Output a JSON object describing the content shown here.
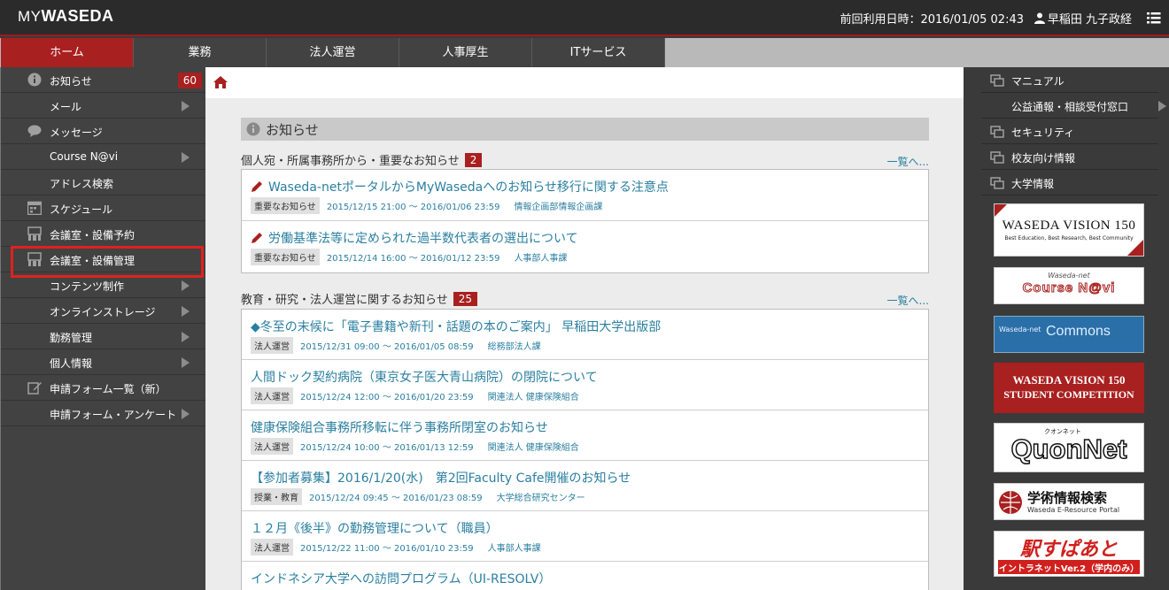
{
  "header": {
    "logo_my": "MY",
    "logo_name": "WASEDA",
    "last_login": "前回利用日時：2016/01/05 02:43",
    "user_name": "早稲田 九子政経"
  },
  "nav": {
    "tabs": [
      {
        "label": "ホーム"
      },
      {
        "label": "業務"
      },
      {
        "label": "法人運営"
      },
      {
        "label": "人事厚生"
      },
      {
        "label": "ITサービス"
      }
    ]
  },
  "sidebar": {
    "items": [
      {
        "label": "お知らせ",
        "badge": "60"
      },
      {
        "label": "メール"
      },
      {
        "label": "メッセージ"
      },
      {
        "label": "Course N@vi"
      },
      {
        "label": "アドレス検索"
      },
      {
        "label": "スケジュール"
      },
      {
        "label": "会議室・設備予約"
      },
      {
        "label": "会議室・設備管理"
      },
      {
        "label": "コンテンツ制作"
      },
      {
        "label": "オンラインストレージ"
      },
      {
        "label": "勤務管理"
      },
      {
        "label": "個人情報"
      },
      {
        "label": "申請フォーム一覧（新）"
      },
      {
        "label": "申請フォーム・アンケート"
      }
    ]
  },
  "main": {
    "section_title": "お知らせ",
    "groups": [
      {
        "title": "個人宛・所属事務所から・重要なお知らせ",
        "count": "2",
        "more": "一覧へ...",
        "items": [
          {
            "title": "Waseda-netポータルからMyWasedaへのお知らせ移行に関する注意点",
            "tag": "重要なお知らせ",
            "period": "2015/12/15 21:00 ～ 2016/01/06 23:59",
            "dept": "情報企画部情報企画課"
          },
          {
            "title": "労働基準法等に定められた過半数代表者の選出について",
            "tag": "重要なお知らせ",
            "period": "2015/12/14 16:00 ～ 2016/01/12 23:59",
            "dept": "人事部人事課"
          }
        ]
      },
      {
        "title": "教育・研究・法人運営に関するお知らせ",
        "count": "25",
        "more": "一覧へ...",
        "items": [
          {
            "title": "◆冬至の末候に「電子書籍や新刊・話題の本のご案内」 早稲田大学出版部",
            "tag": "法人運営",
            "period": "2015/12/31 09:00 ～ 2016/01/05 08:59",
            "dept": "総務部法人課"
          },
          {
            "title": "人間ドック契約病院（東京女子医大青山病院）の閉院について",
            "tag": "法人運営",
            "period": "2015/12/24 12:00 ～ 2016/01/20 23:59",
            "dept": "関連法人 健康保険組合"
          },
          {
            "title": "健康保険組合事務所移転に伴う事務所閉室のお知らせ",
            "tag": "法人運営",
            "period": "2015/12/24 10:00 ～ 2016/01/13 12:59",
            "dept": "関連法人 健康保険組合"
          },
          {
            "title": "【参加者募集】2016/1/20(水)　第2回Faculty Cafe開催のお知らせ",
            "tag": "授業・教育",
            "period": "2015/12/24 09:45 ～ 2016/01/23 08:59",
            "dept": "大学総合研究センター"
          },
          {
            "title": "１２月《後半》の勤務管理について（職員）",
            "tag": "法人運営",
            "period": "2015/12/22 11:00 ～ 2016/01/10 23:59",
            "dept": "人事部人事課"
          },
          {
            "title": "インドネシア大学への訪問プログラム（UI-RESOLV）",
            "tag": "",
            "period": "",
            "dept": ""
          }
        ]
      }
    ]
  },
  "right_sidebar": {
    "items": [
      {
        "label": "マニュアル"
      },
      {
        "label": "公益通報・相談受付窓口"
      },
      {
        "label": "セキュリティ"
      },
      {
        "label": "校友向け情報"
      },
      {
        "label": "大学情報"
      }
    ],
    "banners": {
      "vision150": {
        "title": "WASEDA VISION 150",
        "subtitle": "Best Education, Best Research, Best Community"
      },
      "coursenavi": {
        "top": "Waseda-net",
        "main": "Course N@vi"
      },
      "commons": {
        "prefix": "Waseda-net",
        "main": "Commons"
      },
      "competition": {
        "line1": "WASEDA VISION 150",
        "line2": "STUDENT COMPETITION"
      },
      "quonnet": {
        "small": "クオンネット",
        "main": "QuonNet"
      },
      "search": {
        "main": "学術情報検索",
        "sub": "Waseda E-Resource Portal"
      },
      "ekisupa": {
        "main": "駅すぱあと",
        "sub": "イントラネットVer.2（学内のみ）"
      }
    }
  },
  "colors": {
    "accent": "#a8201f",
    "link": "#2a7fa0",
    "highlight": "#e0211e",
    "sidebar": "#424242"
  }
}
